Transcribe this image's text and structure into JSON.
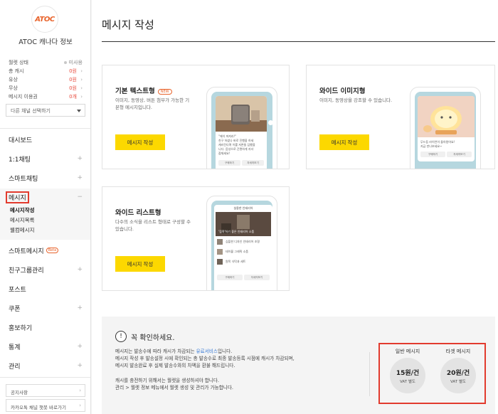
{
  "sidebar": {
    "logo_text": "ATOC",
    "channel_name": "ATOC 캐나다 정보",
    "stats": [
      {
        "label": "월렛 상태",
        "value": "미사용"
      },
      {
        "label": "총 캐시",
        "value": "0원"
      },
      {
        "label": "유상",
        "value": "0원"
      },
      {
        "label": "무상",
        "value": "0원"
      },
      {
        "label": "메시지 이용권",
        "value": "0개"
      }
    ],
    "channel_select": "다른 채널 선택하기",
    "nav": [
      {
        "label": "대시보드"
      },
      {
        "label": "1:1채팅"
      },
      {
        "label": "스마트채팅"
      },
      {
        "label": "메시지"
      },
      {
        "label": "스마트메시지",
        "badge": "Beta"
      },
      {
        "label": "친구그룹관리"
      },
      {
        "label": "포스트"
      },
      {
        "label": "쿠폰"
      },
      {
        "label": "홍보하기"
      },
      {
        "label": "통계"
      },
      {
        "label": "관리"
      }
    ],
    "sub_items": [
      "메시지작성",
      "메시지목록",
      "웰컴메시지"
    ],
    "footer_links": [
      "공지사항",
      "카카오톡 채널 챗봇 바로가기"
    ]
  },
  "main": {
    "title": "메시지 작성",
    "cards": [
      {
        "title": "기본 텍스트형",
        "badge": "NEW",
        "desc": [
          "이미지, 동영상, 버튼 첨부가 가능한 기",
          "본형 메시지입니다."
        ],
        "button": "메시지 작성",
        "preview_text": [
          "\"에이 꺼져라!\"",
          "친구 하셨나 바로 진행을 하세",
          "캐러진다며 이를 저론들 답했을",
          "니다. 음성으로 간편하게 자녀",
          "잠재세요!"
        ],
        "preview_buttons": [
          "구매하기",
          "자세히보기"
        ]
      },
      {
        "title": "와이드 이미지형",
        "desc": [
          "이미지, 동영상을 강조할 수 있습니다."
        ],
        "button": "메시지 작성",
        "preview_text": [
          "무드등 라이언이 돌아왔어요!",
          "지금 만나보세요~"
        ],
        "preview_buttons": [
          "구매하기",
          "자세히보기"
        ]
      },
      {
        "title": "와이드 리스트형",
        "desc": [
          "다수의 소식을 리스트 형태로 구성할 수",
          "있습니다."
        ],
        "button": "메시지 작성",
        "preview_header": "실용한 인테리어",
        "preview_caption": "'집콕'하기 좋은 인테리어 소품",
        "preview_items": [
          "심플한 디자인 인테리어 조명",
          "테이블 그래픽 소품",
          "원목 식탁과 세트"
        ],
        "preview_buttons": [
          "구매하기",
          "자세히보기"
        ]
      }
    ],
    "notice": {
      "icon": "!",
      "title": "꼭 확인하세요.",
      "lines": [
        {
          "pre": "메시지는 발송수에 따라 캐시가 차감되는 ",
          "link": "유료서비스",
          "post": "입니다."
        },
        {
          "pre": "메시지 작성 후 발송설정 시에 확인되는 총 발송수로 최종 발송등록 시점에 캐시가 차감되며,",
          "link": "",
          "post": ""
        },
        {
          "pre": "메시지 발송완료 후 실제 발송수와의 차액을 환불 해드립니다.",
          "link": "",
          "post": ""
        },
        {
          "pre": "캐시를 충전하기 위해서는 월렛을 생성하셔야 합니다.",
          "link": "",
          "post": ""
        },
        {
          "pre": "관리 > 월렛 정보 메뉴에서 월렛 생성 및 관리가 가능합니다.",
          "link": "",
          "post": ""
        }
      ],
      "prices": [
        {
          "label": "일반 메시지",
          "value": "15원/건",
          "vat": "VAT 별도"
        },
        {
          "label": "타겟 메시지",
          "value": "20원/건",
          "vat": "VAT 별도"
        }
      ]
    }
  },
  "colors": {
    "accent_yellow": "#fcd800",
    "highlight_red": "#e23b2e",
    "link_blue": "#3a7bd5",
    "value_red": "#e84a3c",
    "brand_orange": "#e8632b"
  }
}
